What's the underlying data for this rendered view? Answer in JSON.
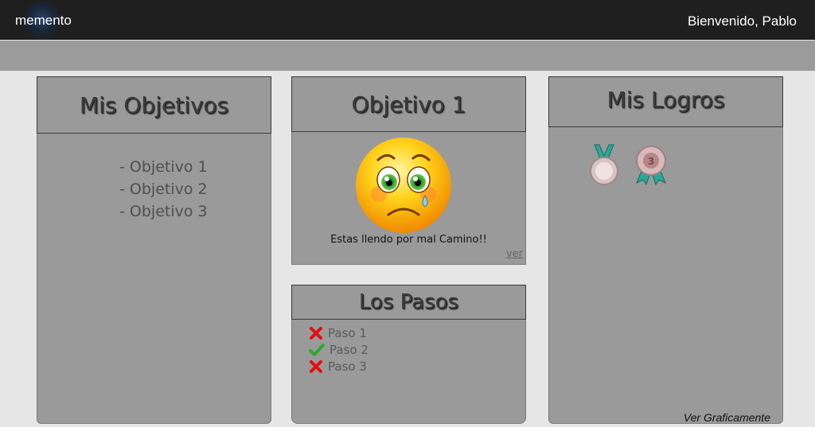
{
  "topbar": {
    "brand": "memento",
    "welcome": "Bienvenido, Pablo"
  },
  "objetivos_panel": {
    "title": "Mis Objetivos",
    "items": [
      "- Objetivo 1",
      "- Objetivo 2",
      "- Objetivo 3"
    ]
  },
  "objetivo_panel": {
    "title": "Objetivo 1",
    "mood_icon": "sad-face-icon",
    "message": "Estas llendo por mal Camino!!",
    "ver_link": "ver"
  },
  "pasos_panel": {
    "title": "Los Pasos",
    "steps": [
      {
        "label": "Paso 1",
        "status": "incomplete",
        "icon": "cross-icon"
      },
      {
        "label": "Paso 2",
        "status": "complete",
        "icon": "check-icon"
      },
      {
        "label": "Paso 3",
        "status": "incomplete",
        "icon": "cross-icon"
      }
    ]
  },
  "logros_panel": {
    "title": "Mis Logros",
    "medals": [
      {
        "icon": "silver-medal-icon",
        "label": ""
      },
      {
        "icon": "bronze-medal-icon",
        "label": "3"
      }
    ],
    "ver_graficamente": "Ver Graficamente"
  },
  "colors": {
    "topbar": "#1f1f1f",
    "panel": "#9a9a9a",
    "background": "#e6e6e6",
    "cross": "#e01010",
    "check": "#2ea82e"
  }
}
